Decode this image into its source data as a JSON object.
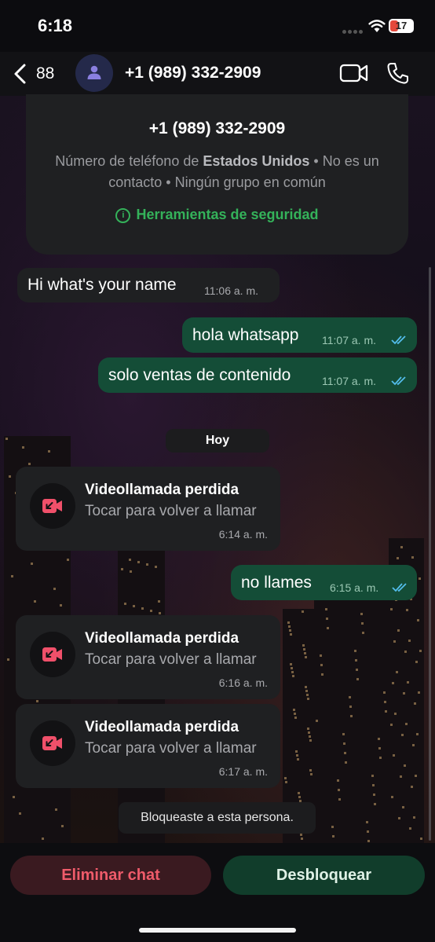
{
  "status_bar": {
    "time": "6:18",
    "battery": "17"
  },
  "header": {
    "back_count": "88",
    "contact_name": "+1 (989) 332-2909"
  },
  "info_card": {
    "number": "+1 (989) 332-2909",
    "desc_prefix": "Número de teléfono de ",
    "desc_country": "Estados Unidos",
    "desc_suffix": " • No es un contacto • Ningún grupo en común",
    "security_link": "Herramientas de seguridad",
    "security_color": "#34b25a"
  },
  "messages": [
    {
      "text": "Hi what's your name",
      "time": "11:06 a. m."
    },
    {
      "text": "hola whatsapp",
      "time": "11:07 a. m."
    },
    {
      "text": "solo ventas de contenido",
      "time": "11:07 a. m."
    },
    {
      "text": "no llames",
      "time": "6:15 a. m."
    }
  ],
  "day_divider": "Hoy",
  "missed_calls": [
    {
      "title": "Videollamada perdida",
      "subtitle": "Tocar para volver a llamar",
      "time": "6:14 a. m."
    },
    {
      "title": "Videollamada perdida",
      "subtitle": "Tocar para volver a llamar",
      "time": "6:16 a. m."
    },
    {
      "title": "Videollamada perdida",
      "subtitle": "Tocar para volver a llamar",
      "time": "6:17 a. m."
    }
  ],
  "system_notice": "Bloqueaste a esta persona.",
  "actions": {
    "delete_label": "Eliminar chat",
    "unblock_label": "Desbloquear"
  },
  "colors": {
    "outgoing_bubble": "#144d37",
    "incoming_bubble": "#1f2022",
    "missed_call_red": "#f0506a",
    "read_ticks": "#53bdeb"
  }
}
